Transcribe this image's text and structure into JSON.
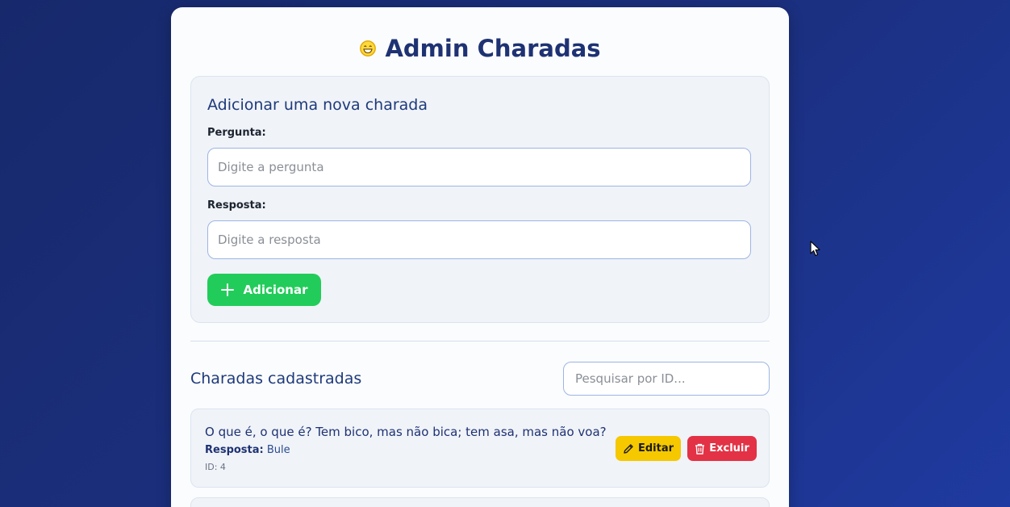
{
  "app": {
    "title": "Admin Charadas",
    "title_icon": "grinning-face-emoji",
    "accent_color": "#22cc5a"
  },
  "add_form": {
    "heading": "Adicionar uma nova charada",
    "question_label": "Pergunta:",
    "question_placeholder": "Digite a pergunta",
    "question_value": "",
    "answer_label": "Resposta:",
    "answer_placeholder": "Digite a resposta",
    "answer_value": "",
    "add_button_label": "Adicionar",
    "add_button_icon": "plus-icon"
  },
  "list": {
    "heading": "Charadas cadastradas",
    "search_placeholder": "Pesquisar por ID...",
    "search_value": "",
    "items": [
      {
        "question": "O que é, o que é? Tem bico, mas não bica; tem asa, mas não voa?",
        "answer_label": "Resposta:",
        "answer": "Bule",
        "id_text": "ID: 4",
        "edit_label": "Editar",
        "edit_icon": "pencil-icon",
        "delete_label": "Excluir",
        "delete_icon": "trash-icon"
      }
    ]
  }
}
